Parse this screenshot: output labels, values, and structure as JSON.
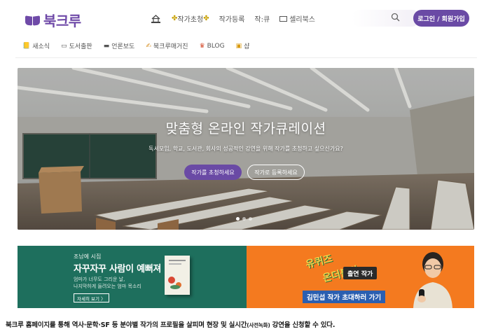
{
  "brand": {
    "logo_text": "북크루",
    "accent_color": "#6a4aa5"
  },
  "nav": {
    "items": [
      {
        "label": "작가초청",
        "icon": "sparkle-icon"
      },
      {
        "label": "작가등록"
      },
      {
        "label": "작:큐"
      },
      {
        "label": "셀리북스",
        "icon": "book-icon"
      }
    ],
    "login_label": "로그인 / 회원가입"
  },
  "subnav": {
    "items": [
      {
        "label": "새소식",
        "icon": "notebook-icon"
      },
      {
        "label": "도서출판",
        "icon": "folder-icon"
      },
      {
        "label": "언론보도",
        "icon": "newspaper-icon"
      },
      {
        "label": "북크루매거진",
        "icon": "pencil-icon"
      },
      {
        "label": "BLOG",
        "icon": "trophy-icon"
      },
      {
        "label": "샵",
        "icon": "gift-icon"
      }
    ]
  },
  "hero": {
    "title": "맞춤형 온라인 작가큐레이션",
    "subtitle": "독서모임, 학교, 도서관, 회사의 성공적인 강연을 위해 작가를 초청하고 싶으신가요?",
    "primary_button": "작가를 초청하세요",
    "secondary_button": "작가로 등록하세요",
    "slides": 3,
    "active_slide": 1
  },
  "banner_left": {
    "author": "조남예 시집",
    "title": "자꾸자꾸 사람이 예뻐져",
    "desc_line1": "엄마가 너무도 그리운 날,",
    "desc_line2": "나지막하게 들려오는 엄마 목소리",
    "more_label": "자세히 보기 〉",
    "color": "#1e6f5d"
  },
  "banner_right": {
    "logo_line1": "유퀴즈",
    "logo_line2": "온더블럭",
    "tag": "출연 작가",
    "cta": "김민섭 작가 초대하러 가기",
    "color": "#f47a1f"
  },
  "caption": {
    "main": "북크루 홈페이지를 통해 역사·문학·SF 등 분야별 작가의 프로필을 살피며 현장 및 실시간",
    "small": "(사전녹화)",
    "tail": " 강연을 신청할 수 있다."
  }
}
